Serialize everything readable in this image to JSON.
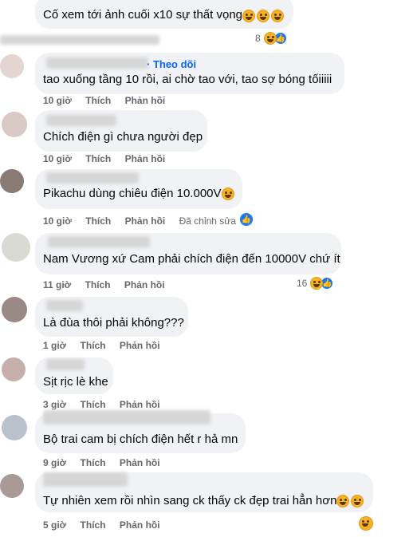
{
  "comments": [
    {
      "text": "Cố xem tới ảnh cuối x10 sự thất vọng",
      "react_count": "8"
    },
    {
      "follow": "· Theo dõi",
      "text": "tao xuống tầng 10 rồi, ai chờ tao với, tao sợ bóng tốiiiii",
      "time": "10 giờ",
      "like": "Thích",
      "reply": "Phản hồi"
    },
    {
      "text": "Chích điện gì chưa người đẹp",
      "time": "10 giờ",
      "like": "Thích",
      "reply": "Phản hồi"
    },
    {
      "text": "Pikachu dùng chiêu điện 10.000V",
      "time": "10 giờ",
      "like": "Thích",
      "reply": "Phản hồi",
      "edited": "Đã chỉnh sửa"
    },
    {
      "text": "Nam Vương xứ Cam phải chích điện đến 10000V chứ ít",
      "time": "11 giờ",
      "like": "Thích",
      "reply": "Phản hồi",
      "react_count": "16"
    },
    {
      "text": "Là đùa thôi phải không???",
      "time": "1 giờ",
      "like": "Thích",
      "reply": "Phản hồi"
    },
    {
      "text": "Sịt rịc lè khe",
      "time": "3 giờ",
      "like": "Thích",
      "reply": "Phản hồi"
    },
    {
      "text": "Bộ trai cam bị chích điện hết r hả mn",
      "time": "9 giờ",
      "like": "Thích",
      "reply": "Phản hồi"
    },
    {
      "text": "Tự nhiên xem rồi nhìn sang ck thấy ck đẹp trai hẳn hơn",
      "time": "5 giờ",
      "like": "Thích",
      "reply": "Phản hồi"
    }
  ],
  "colors": {
    "bubble": "#f0f2f5",
    "meta": "#65676b",
    "follow": "#0866ff",
    "like_badge": "#1877f2",
    "emoji": "#f7b125"
  },
  "icons": {
    "laugh": "laughing-emoji-icon",
    "like": "like-reaction-icon",
    "shock": "shocked-emoji-icon"
  }
}
